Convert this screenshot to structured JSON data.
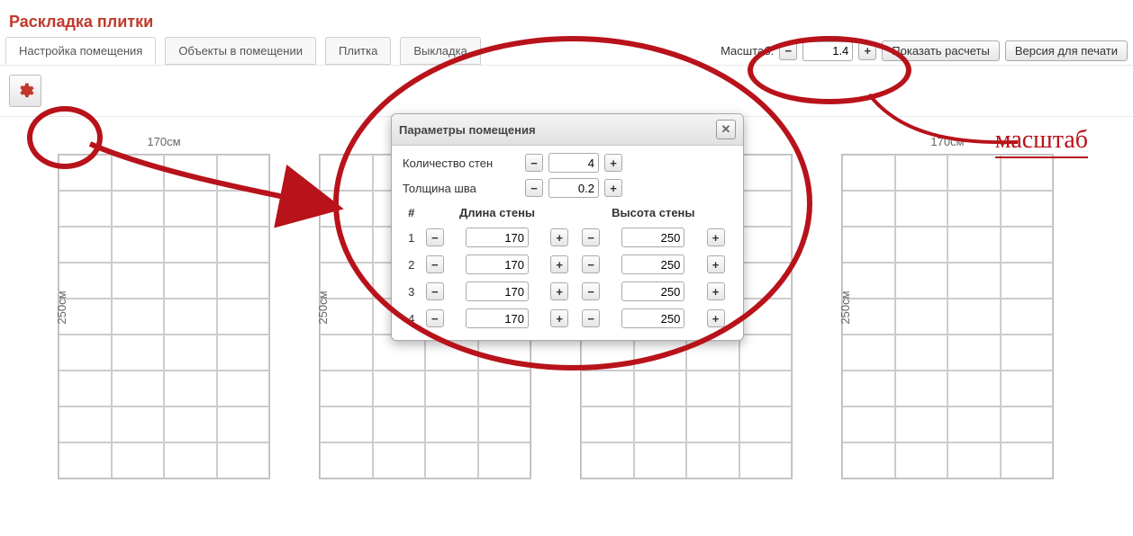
{
  "title": "Раскладка плитки",
  "tabs": [
    "Настройка помещения",
    "Объекты в помещении",
    "Плитка",
    "Выкладка"
  ],
  "scale": {
    "label": "Масштаб:",
    "value": "1.4"
  },
  "buttons": {
    "calc": "Показать расчеты",
    "print": "Версия для печати"
  },
  "dialog": {
    "title": "Параметры помещения",
    "walls_label": "Количество стен",
    "walls_value": "4",
    "seam_label": "Толщина шва",
    "seam_value": "0.2",
    "cols": {
      "num": "#",
      "len": "Длина стены",
      "h": "Высота стены"
    },
    "rows": [
      {
        "n": "1",
        "len": "170",
        "h": "250"
      },
      {
        "n": "2",
        "len": "170",
        "h": "250"
      },
      {
        "n": "3",
        "len": "170",
        "h": "250"
      },
      {
        "n": "4",
        "len": "170",
        "h": "250"
      }
    ]
  },
  "walls": {
    "width": "170см",
    "height": "250см"
  },
  "anno": "масштаб"
}
